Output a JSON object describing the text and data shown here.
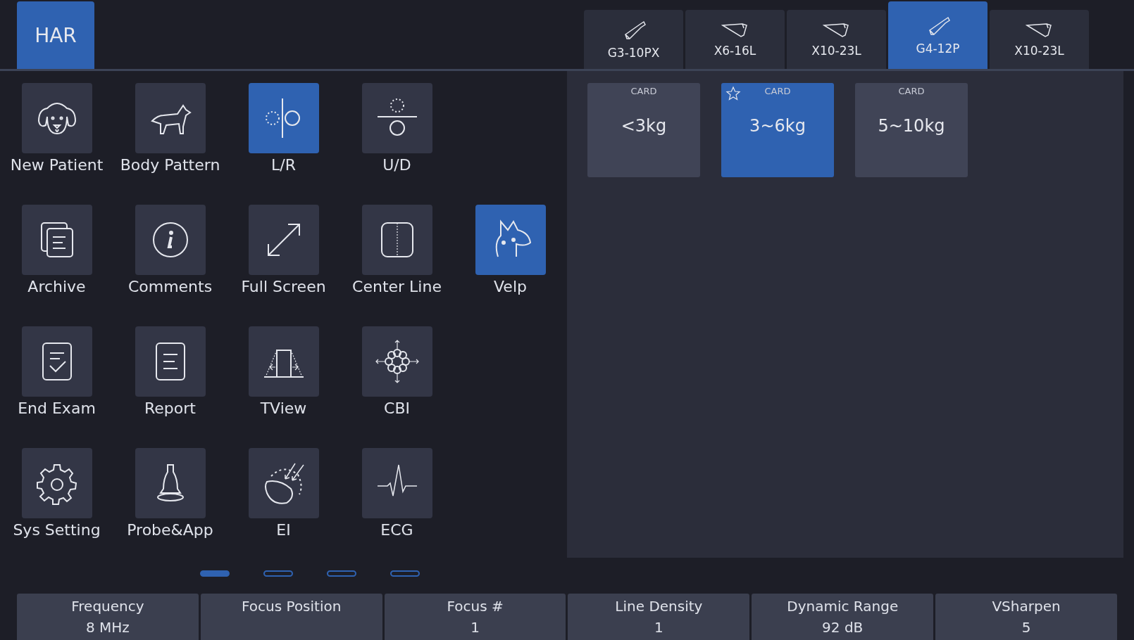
{
  "exam_tab": {
    "label": "HAR",
    "selected": true
  },
  "probe_tabs": [
    {
      "label": "G3-10PX",
      "selected": false
    },
    {
      "label": "X6-16L",
      "selected": false
    },
    {
      "label": "X10-23L",
      "selected": false
    },
    {
      "label": "G4-12P",
      "selected": true
    },
    {
      "label": "X10-23L",
      "selected": false
    }
  ],
  "functions": [
    {
      "label": "New Patient",
      "on": false
    },
    {
      "label": "Body Pattern",
      "on": false
    },
    {
      "label": "L/R",
      "on": true
    },
    {
      "label": "U/D",
      "on": false
    },
    {
      "label": "Archive",
      "on": false
    },
    {
      "label": "Comments",
      "on": false
    },
    {
      "label": "Full Screen",
      "on": false
    },
    {
      "label": "Center Line",
      "on": false
    },
    {
      "label": "Velp",
      "on": true
    },
    {
      "label": "End Exam",
      "on": false
    },
    {
      "label": "Report",
      "on": false
    },
    {
      "label": "TView",
      "on": false
    },
    {
      "label": "CBI",
      "on": false
    },
    {
      "label": "Sys Setting",
      "on": false
    },
    {
      "label": "Probe&App",
      "on": false
    },
    {
      "label": "EI",
      "on": false
    },
    {
      "label": "ECG",
      "on": false
    }
  ],
  "presets": [
    {
      "category": "CARD",
      "label": "<3kg",
      "selected": false,
      "favorite": false
    },
    {
      "category": "CARD",
      "label": "3~6kg",
      "selected": true,
      "favorite": true
    },
    {
      "category": "CARD",
      "label": "5~10kg",
      "selected": false,
      "favorite": false
    }
  ],
  "pages": [
    {
      "selected": true
    },
    {
      "selected": false
    },
    {
      "selected": false
    },
    {
      "selected": false
    }
  ],
  "parameters": [
    {
      "label": "Frequency",
      "value": "8 MHz"
    },
    {
      "label": "Focus Position"
    },
    {
      "label": "Focus #",
      "value": "1"
    },
    {
      "label": "Line Density",
      "value": "1"
    },
    {
      "label": "Dynamic Range",
      "value": "92 dB"
    },
    {
      "label": "VSharpen",
      "value": "5"
    }
  ]
}
